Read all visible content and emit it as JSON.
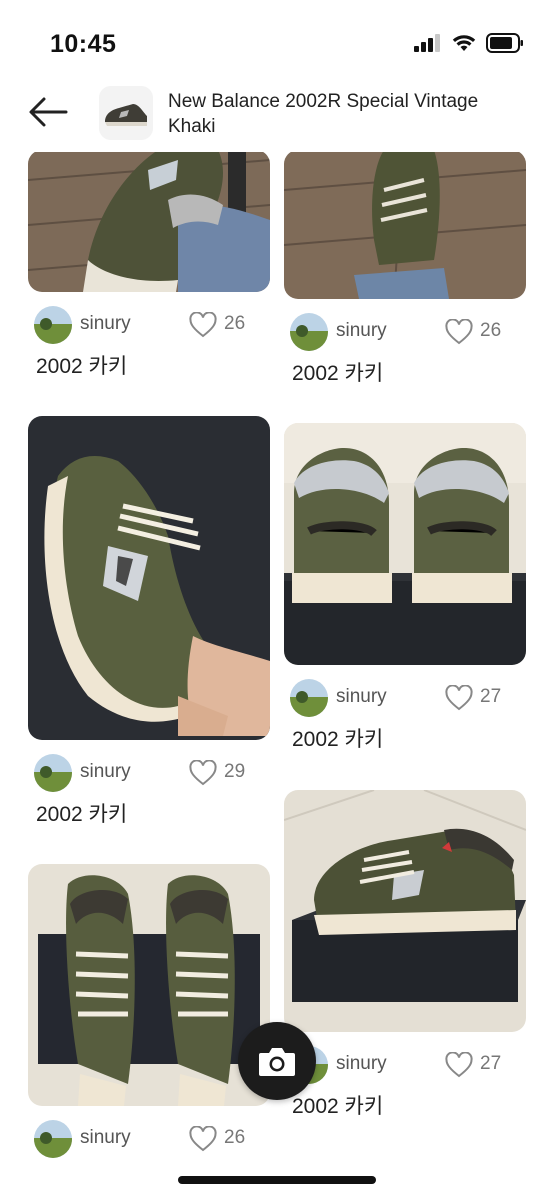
{
  "status_bar": {
    "time": "10:45"
  },
  "header": {
    "title": "New Balance 2002R Special Vintage Khaki"
  },
  "posts": [
    {
      "user": "sinury",
      "likes": "26",
      "caption": "2002 카키"
    },
    {
      "user": "sinury",
      "likes": "26",
      "caption": "2002 카키"
    },
    {
      "user": "sinury",
      "likes": "29",
      "caption": "2002 카키"
    },
    {
      "user": "sinury",
      "likes": "27",
      "caption": "2002 카키"
    },
    {
      "user": "sinury",
      "likes": "26",
      "caption": ""
    },
    {
      "user": "sinury",
      "likes": "27",
      "caption": "2002 카키"
    }
  ],
  "colors": {
    "shoe_khaki": "#5b6142",
    "shoe_dark": "#3d3a33",
    "sole_cream": "#efe6d3",
    "box_dark": "#22252a"
  }
}
